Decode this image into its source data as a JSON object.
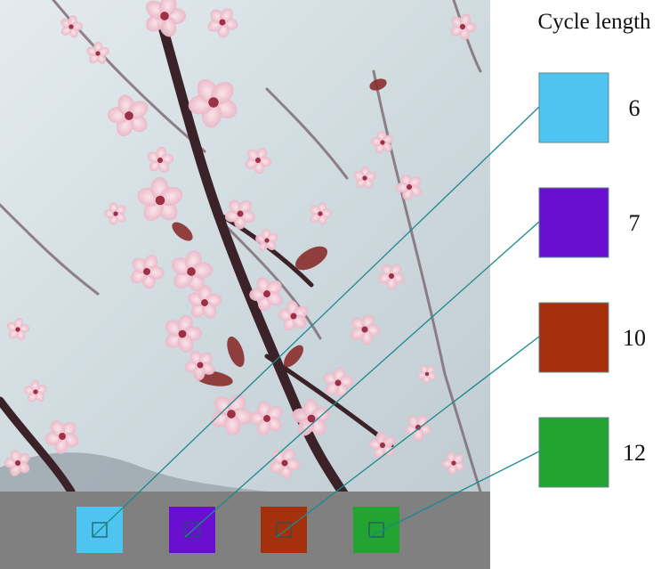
{
  "legend": {
    "title": "Cycle length",
    "items": [
      {
        "value": "6",
        "color": "#4fc4f0"
      },
      {
        "value": "7",
        "color": "#6a0fd0"
      },
      {
        "value": "10",
        "color": "#a6300c"
      },
      {
        "value": "12",
        "color": "#23a332"
      }
    ]
  },
  "colors": {
    "connector": "#1b8a8a",
    "strip": "#808080",
    "sky": "#d3dde2",
    "branch": "#3b2128",
    "blossom": "#f0c4d0",
    "blossom_center": "#9c3048",
    "leaf": "#8a2c2c",
    "hill": "#9aa4ab"
  }
}
